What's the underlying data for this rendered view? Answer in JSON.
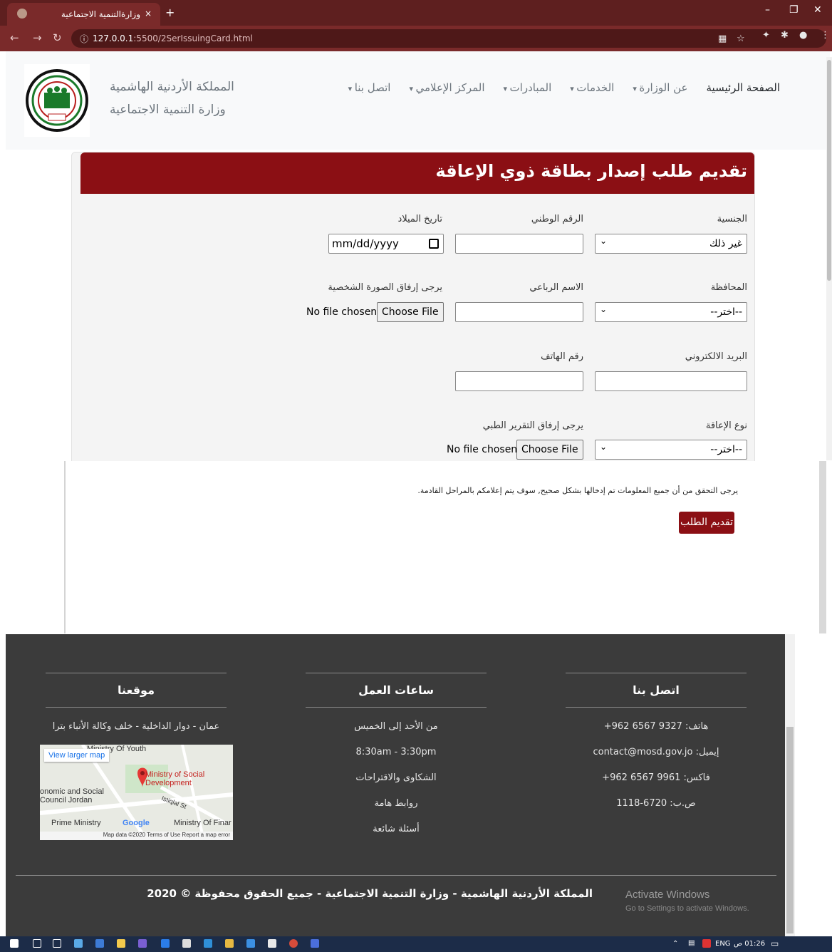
{
  "browser": {
    "tab_title": "وزارةالتنمية الاجتماعية",
    "tab_close": "×",
    "new_tab": "+",
    "url_host": "127.0.0.1",
    "url_rest": ":5500/2SerIssuingCard.html",
    "minimize": "–",
    "maximize": "❐",
    "close": "✕"
  },
  "header": {
    "brand_line1": "المملكة الأردنية الهاشمية",
    "brand_line2": "وزارة التنمية الاجتماعية",
    "nav": [
      {
        "label": "الصفحة الرئيسية",
        "dropdown": false
      },
      {
        "label": "عن الوزارة",
        "dropdown": true
      },
      {
        "label": "الخدمات",
        "dropdown": true
      },
      {
        "label": "المبادرات",
        "dropdown": true
      },
      {
        "label": "المركز الإعلامي",
        "dropdown": true
      },
      {
        "label": "اتصل بنا",
        "dropdown": true
      }
    ]
  },
  "form": {
    "title": "تقديم طلب إصدار بطاقة ذوي الإعاقة",
    "nationality_label": "الجنسية",
    "nationality_value": "غير ذلك",
    "national_id_label": "الرقم الوطني",
    "birthdate_label": "تاريخ الميلاد",
    "birthdate_placeholder": "mm/dd/yyyy",
    "governorate_label": "المحافظة",
    "governorate_value": "--اختر--",
    "fullname_label": "الاسم الرباعي",
    "photo_label": "يرجى إرفاق الصورة الشخصية",
    "email_label": "البريد الالكتروني",
    "phone_label": "رقم الهاتف",
    "disability_label": "نوع الإعاقة",
    "disability_value": "--اختر--",
    "report_label": "يرجى إرفاق التقرير الطبي",
    "choose_file": "Choose File",
    "no_file": "No file chosen",
    "notice": "يرجى التحقق من أن جميع المعلومات تم إدخالها بشكل صحيح, سوف يتم إعلامكم بالمراحل القادمة.",
    "submit": "تقديم الطلب"
  },
  "footer": {
    "contact": {
      "title": "اتصل بنا",
      "items": [
        "هاتف: 9327 6567 962+",
        "إيميل: contact@mosd.gov.jo",
        "فاكس: 9961 6567 962+",
        "ص.ب: 6720-1118"
      ]
    },
    "hours": {
      "title": "ساعات العمل",
      "items": [
        "من الأحد إلى الخميس",
        "8:30am - 3:30pm",
        "الشكاوى والاقتراحات",
        "روابط هامة",
        "أسئلة شائعة"
      ]
    },
    "location": {
      "title": "موقعنا",
      "address": "عمان - دوار الداخلية - خلف وكالة الأنباء بترا",
      "map": {
        "view_larger": "View larger map",
        "label1": "Ministry Of Youth",
        "label2": "Ministry of Social Development",
        "label3": "onomic and Social Council Jordan",
        "label4": "Prime Ministry",
        "label5": "Ministry Of Finar",
        "street": "Istiqlal St",
        "google": "Google",
        "footer": "Map data ©2020   Terms of Use   Report a map error"
      }
    },
    "copyright": "المملكة الأردنية الهاشمية - وزارة التنمية الاجتماعية - جميع الحقوق محفوظة © 2020",
    "activate_title": "Activate Windows",
    "activate_sub": "Go to Settings to activate Windows."
  },
  "taskbar": {
    "lang": "ENG",
    "time": "01:26 ص"
  },
  "colors": {
    "brand_red": "#8b0f14",
    "footer_bg": "#3b3b3b",
    "chrome_tab": "#5e1f1f"
  }
}
